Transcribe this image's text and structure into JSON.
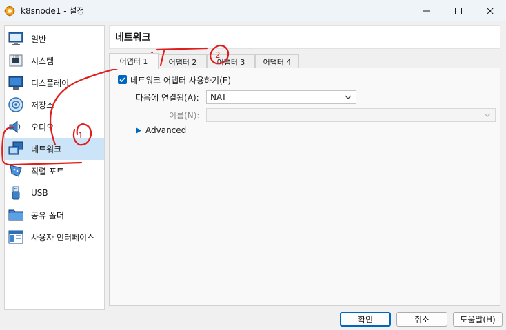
{
  "window": {
    "title": "k8snode1 - 설정",
    "icons": {
      "app": "virtualbox-icon",
      "minimize": "minimize-icon",
      "maximize": "maximize-icon",
      "close": "close-icon"
    }
  },
  "sidebar": {
    "items": [
      {
        "label": "일반",
        "icon": "general-icon"
      },
      {
        "label": "시스템",
        "icon": "system-chip-icon"
      },
      {
        "label": "디스플레이",
        "icon": "display-monitor-icon"
      },
      {
        "label": "저장소",
        "icon": "storage-disc-icon"
      },
      {
        "label": "오디오",
        "icon": "audio-speaker-icon"
      },
      {
        "label": "네트워크",
        "icon": "network-icon",
        "selected": true
      },
      {
        "label": "직렬 포트",
        "icon": "serial-port-icon"
      },
      {
        "label": "USB",
        "icon": "usb-icon"
      },
      {
        "label": "공유 폴더",
        "icon": "shared-folder-icon"
      },
      {
        "label": "사용자 인터페이스",
        "icon": "user-interface-icon"
      }
    ]
  },
  "main": {
    "title": "네트워크",
    "tabs": [
      {
        "label": "어댑터 1",
        "active": true
      },
      {
        "label": "어댑터 2"
      },
      {
        "label": "어댑터 3"
      },
      {
        "label": "어댑터 4"
      }
    ],
    "enable_adapter": {
      "label": "네트워크 어댑터 사용하기(E)",
      "checked": true
    },
    "attached_to": {
      "label": "다음에 연결됨(A):",
      "value": "NAT"
    },
    "name": {
      "label": "이름(N):",
      "value": "",
      "disabled": true
    },
    "advanced": {
      "label": "Advanced",
      "expanded": false
    }
  },
  "buttons": {
    "ok": "확인",
    "cancel": "취소",
    "help": "도움말(H)"
  },
  "annotations": {
    "marker_1": "1",
    "marker_2": "2",
    "color": "#e01e1e"
  },
  "colors": {
    "accent": "#0067c0",
    "selected_bg": "#cce4f7"
  }
}
